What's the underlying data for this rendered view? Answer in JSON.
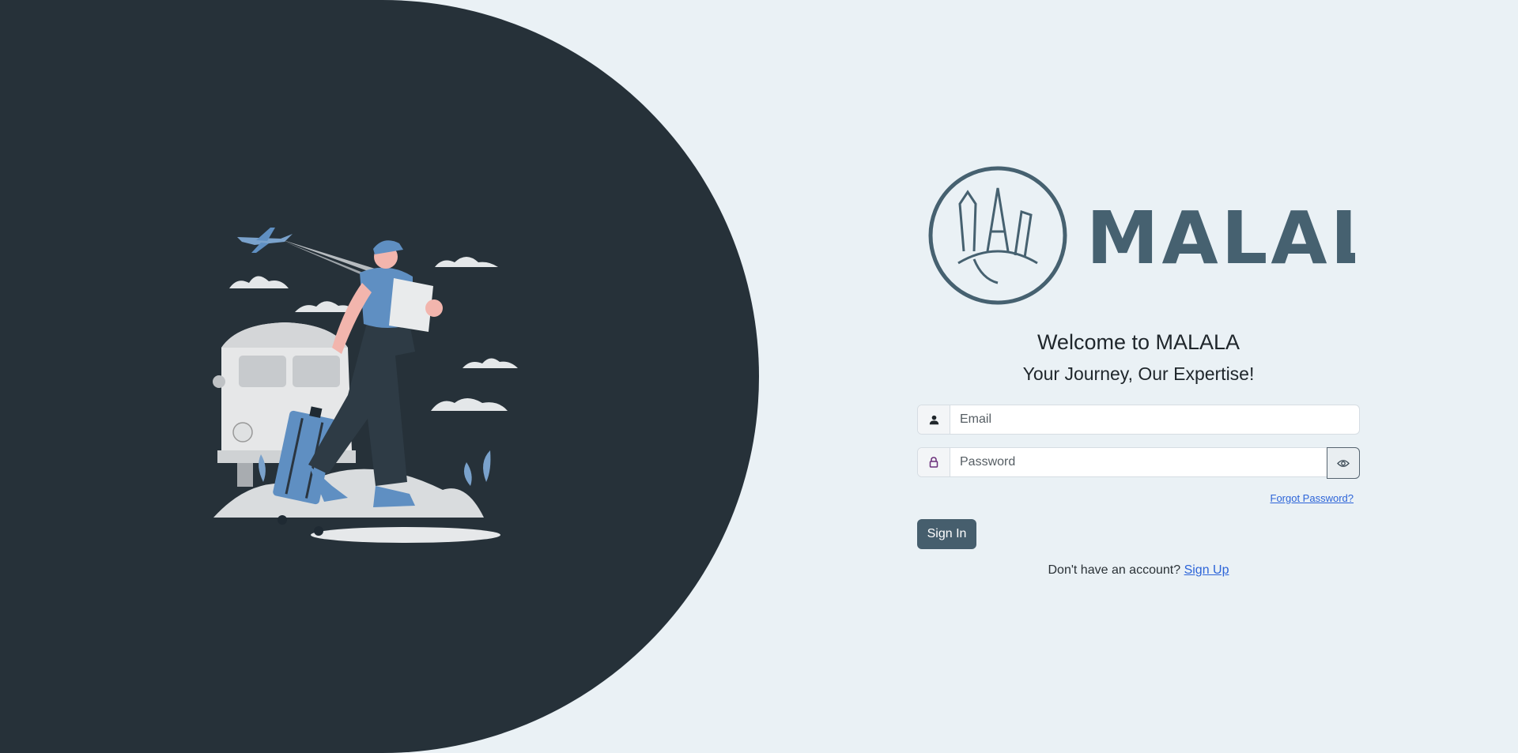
{
  "brand": {
    "name": "MALALA",
    "color": "#466170"
  },
  "welcome": {
    "title": "Welcome to MALALA",
    "tagline": "Your Journey, Our Expertise!"
  },
  "form": {
    "email_placeholder": "Email",
    "password_placeholder": "Password",
    "email_icon": "user-icon",
    "password_icon": "lock-icon",
    "toggle_icon": "eye-icon",
    "forgot_label": "Forgot Password?",
    "signin_label": "Sign In",
    "signup_prompt": "Don't have an account?",
    "signup_label": "Sign Up"
  },
  "colors": {
    "panel": "#263139",
    "background": "#eaf1f5",
    "button": "#465e6d",
    "link": "#2c64d8"
  }
}
